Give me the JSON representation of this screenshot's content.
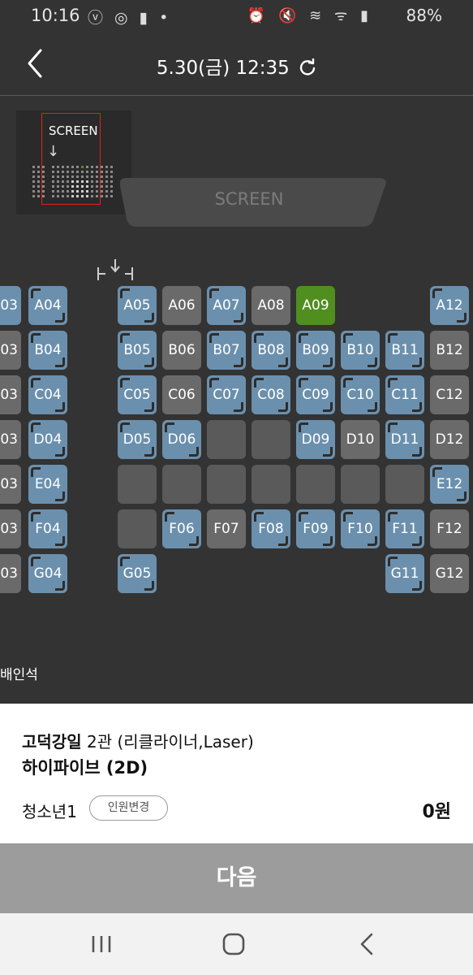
{
  "status_bar": {
    "time": "10:16",
    "left_icons": "ⓥ ◎ ▮ •",
    "right_icons": "⏰ 🔇 ≋ ᯤ ▮",
    "battery": "88%"
  },
  "header": {
    "title": "5.30(금) 12:35",
    "back_icon": "chevron-left-icon",
    "refresh_icon": "refresh-icon"
  },
  "minimap": {
    "label": "SCREEN",
    "arrow": "↓"
  },
  "screen_label": "SCREEN",
  "seat_colors": {
    "available": "#6b90ad",
    "sold": "#6a6a6a",
    "empty": "#5a5a5a",
    "selected": "#4f8e1f"
  },
  "rows": [
    {
      "row": "A",
      "seats": [
        {
          "label": "03",
          "state": "available",
          "cut": true
        },
        {
          "label": "A04",
          "state": "available"
        },
        {
          "label": "A05",
          "state": "available"
        },
        {
          "label": "A06",
          "state": "sold"
        },
        {
          "label": "A07",
          "state": "available"
        },
        {
          "label": "A08",
          "state": "sold"
        },
        {
          "label": "A09",
          "state": "selected"
        },
        {
          "label": "A12",
          "state": "available"
        }
      ]
    },
    {
      "row": "B",
      "seats": [
        {
          "label": "03",
          "state": "sold",
          "cut": true
        },
        {
          "label": "B04",
          "state": "available"
        },
        {
          "label": "B05",
          "state": "available"
        },
        {
          "label": "B06",
          "state": "sold"
        },
        {
          "label": "B07",
          "state": "available"
        },
        {
          "label": "B08",
          "state": "available"
        },
        {
          "label": "B09",
          "state": "available"
        },
        {
          "label": "B10",
          "state": "available"
        },
        {
          "label": "B11",
          "state": "available"
        },
        {
          "label": "B12",
          "state": "sold"
        }
      ]
    },
    {
      "row": "C",
      "seats": [
        {
          "label": "03",
          "state": "sold",
          "cut": true
        },
        {
          "label": "C04",
          "state": "available"
        },
        {
          "label": "C05",
          "state": "available"
        },
        {
          "label": "C06",
          "state": "sold"
        },
        {
          "label": "C07",
          "state": "available"
        },
        {
          "label": "C08",
          "state": "available"
        },
        {
          "label": "C09",
          "state": "available"
        },
        {
          "label": "C10",
          "state": "available"
        },
        {
          "label": "C11",
          "state": "available"
        },
        {
          "label": "C12",
          "state": "sold"
        }
      ]
    },
    {
      "row": "D",
      "seats": [
        {
          "label": "03",
          "state": "sold",
          "cut": true
        },
        {
          "label": "D04",
          "state": "available"
        },
        {
          "label": "D05",
          "state": "available"
        },
        {
          "label": "D06",
          "state": "available"
        },
        {
          "label": "",
          "state": "empty"
        },
        {
          "label": "",
          "state": "empty"
        },
        {
          "label": "D09",
          "state": "available"
        },
        {
          "label": "D10",
          "state": "sold"
        },
        {
          "label": "D11",
          "state": "available"
        },
        {
          "label": "D12",
          "state": "sold"
        }
      ]
    },
    {
      "row": "E",
      "seats": [
        {
          "label": "03",
          "state": "sold",
          "cut": true
        },
        {
          "label": "E04",
          "state": "available"
        },
        {
          "label": "",
          "state": "empty"
        },
        {
          "label": "",
          "state": "empty"
        },
        {
          "label": "",
          "state": "empty"
        },
        {
          "label": "",
          "state": "empty"
        },
        {
          "label": "",
          "state": "empty"
        },
        {
          "label": "",
          "state": "empty"
        },
        {
          "label": "",
          "state": "empty"
        },
        {
          "label": "E12",
          "state": "available"
        }
      ]
    },
    {
      "row": "F",
      "seats": [
        {
          "label": "03",
          "state": "sold",
          "cut": true
        },
        {
          "label": "F04",
          "state": "available"
        },
        {
          "label": "",
          "state": "empty"
        },
        {
          "label": "F06",
          "state": "available"
        },
        {
          "label": "F07",
          "state": "sold"
        },
        {
          "label": "F08",
          "state": "available"
        },
        {
          "label": "F09",
          "state": "available"
        },
        {
          "label": "F10",
          "state": "available"
        },
        {
          "label": "F11",
          "state": "available"
        },
        {
          "label": "F12",
          "state": "sold"
        }
      ]
    },
    {
      "row": "G",
      "seats": [
        {
          "label": "03",
          "state": "sold",
          "cut": true
        },
        {
          "label": "G04",
          "state": "available"
        },
        {
          "label": "G05",
          "state": "available"
        },
        {
          "label": "G11",
          "state": "available"
        },
        {
          "label": "G12",
          "state": "sold"
        }
      ]
    }
  ],
  "legend_text": "배인석",
  "booking": {
    "theater_bold": "고덕강일",
    "theater_rest": " 2관 (리클라이너,Laser)",
    "movie": "하이파이브 (2D)",
    "audience": "청소년1",
    "change_button": "인원변경",
    "price": "0원"
  },
  "next_button": "다음",
  "navbar": {
    "recent_icon": "recent-apps-icon",
    "home_icon": "home-icon",
    "back_icon": "back-icon"
  }
}
